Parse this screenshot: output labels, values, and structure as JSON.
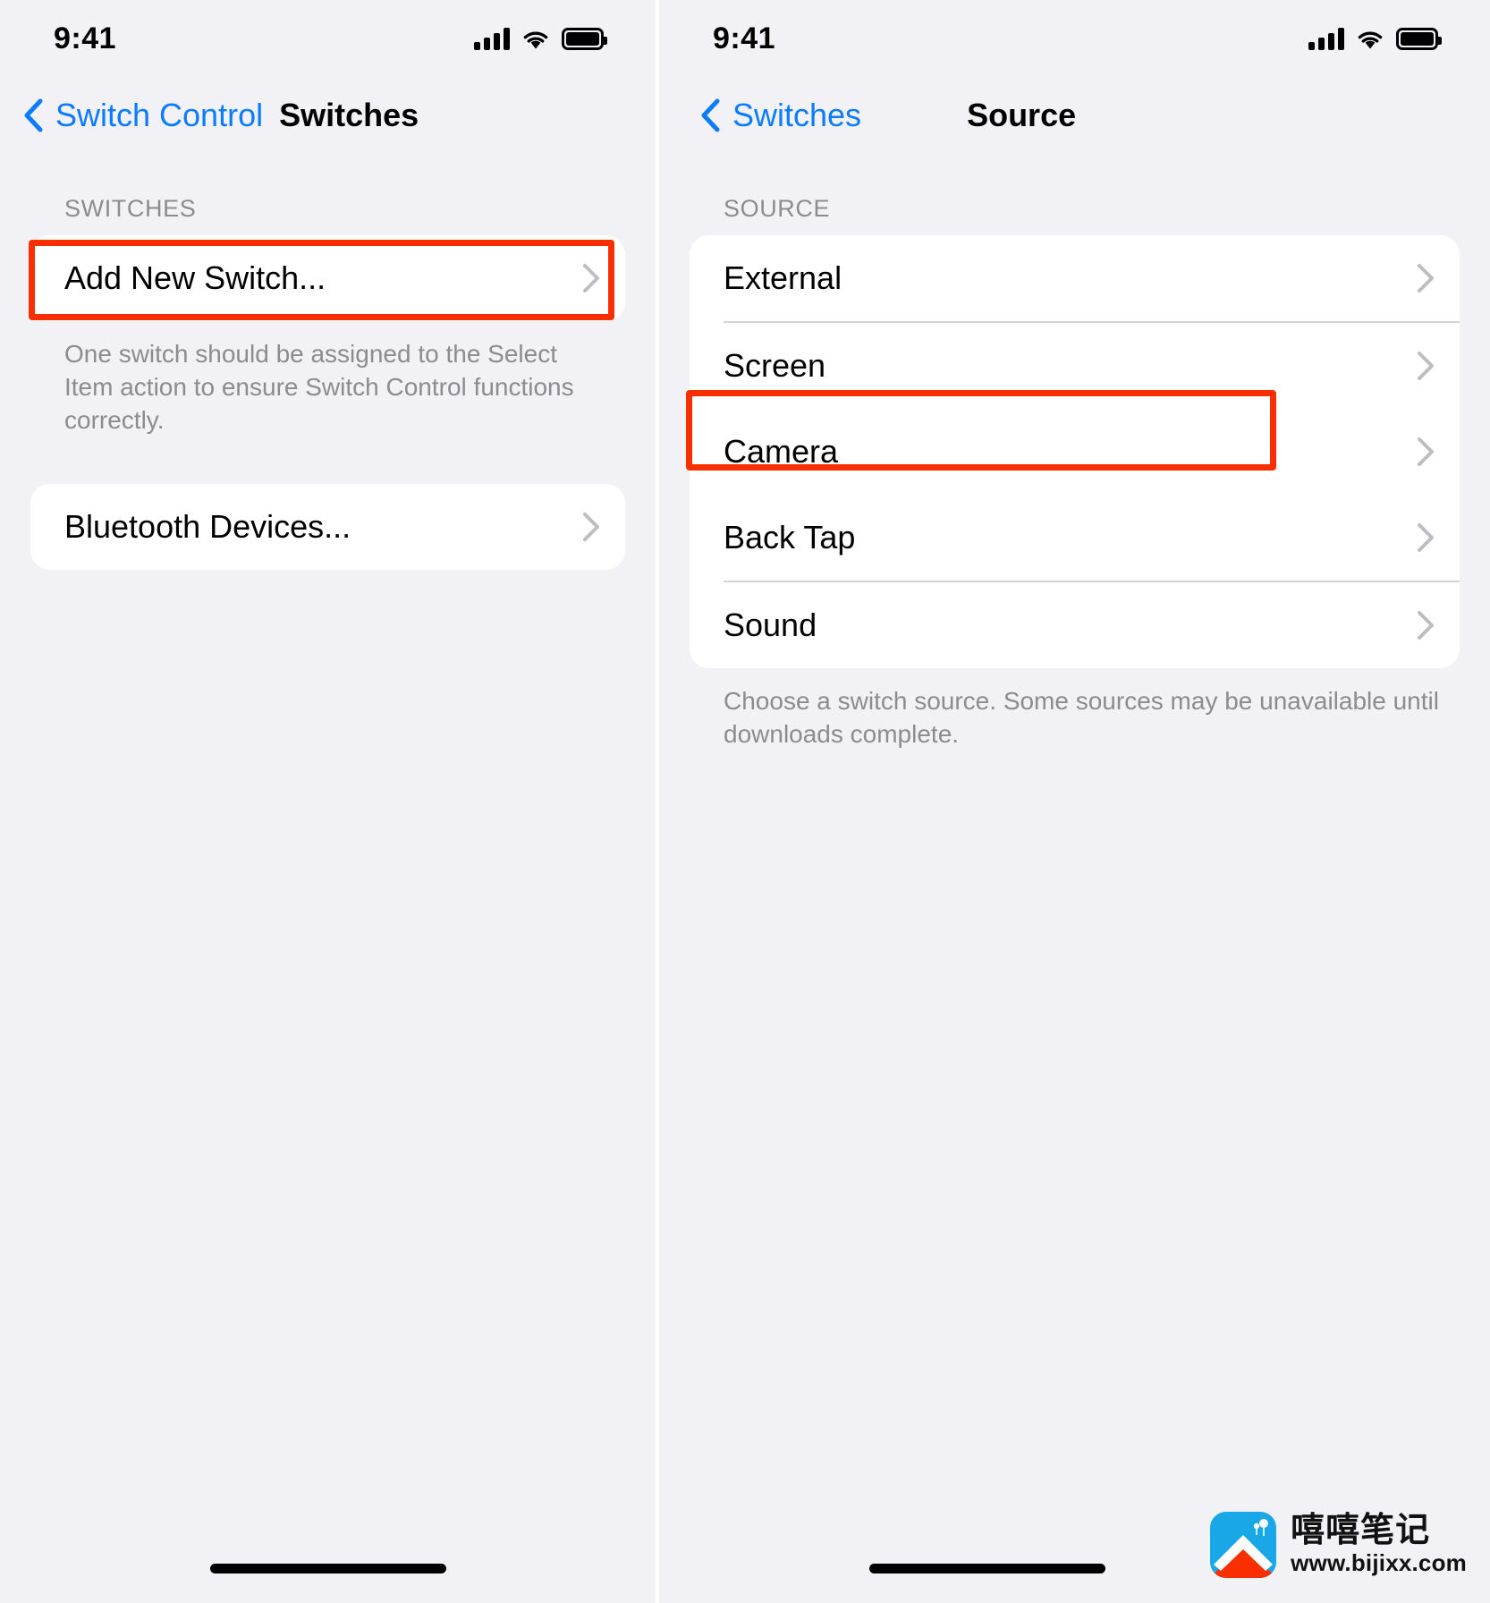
{
  "status_bar": {
    "time": "9:41",
    "icons": [
      "cellular-signal-icon",
      "wifi-icon",
      "battery-icon"
    ]
  },
  "left_panel": {
    "nav": {
      "back_label": "Switch Control",
      "title": "Switches",
      "back_icon": "chevron-left-icon"
    },
    "section_header": "SWITCHES",
    "rows": [
      {
        "label": "Add New Switch...",
        "accessory": "chevron-right-icon",
        "highlighted": true
      }
    ],
    "footnote": "One switch should be assigned to the Select Item action to ensure Switch Control functions correctly.",
    "second_card_rows": [
      {
        "label": "Bluetooth Devices...",
        "accessory": "chevron-right-icon",
        "highlighted": false
      }
    ]
  },
  "right_panel": {
    "nav": {
      "back_label": "Switches",
      "title": "Source",
      "back_icon": "chevron-left-icon"
    },
    "section_header": "SOURCE",
    "rows": [
      {
        "label": "External",
        "accessory": "chevron-right-icon",
        "highlighted": false
      },
      {
        "label": "Screen",
        "accessory": "chevron-right-icon",
        "highlighted": false
      },
      {
        "label": "Camera",
        "accessory": "chevron-right-icon",
        "highlighted": true
      },
      {
        "label": "Back Tap",
        "accessory": "chevron-right-icon",
        "highlighted": false
      },
      {
        "label": "Sound",
        "accessory": "chevron-right-icon",
        "highlighted": false
      }
    ],
    "footnote": "Choose a switch source. Some sources may be unavailable until downloads complete."
  },
  "watermark": {
    "name": "嘻嘻笔记",
    "url": "www.bijixx.com"
  },
  "colors": {
    "accent_blue": "#0a7cff",
    "highlight_red": "#fa2f00",
    "background": "#f2f1f6",
    "card": "#ffffff",
    "secondary_text": "#8b8b91"
  }
}
